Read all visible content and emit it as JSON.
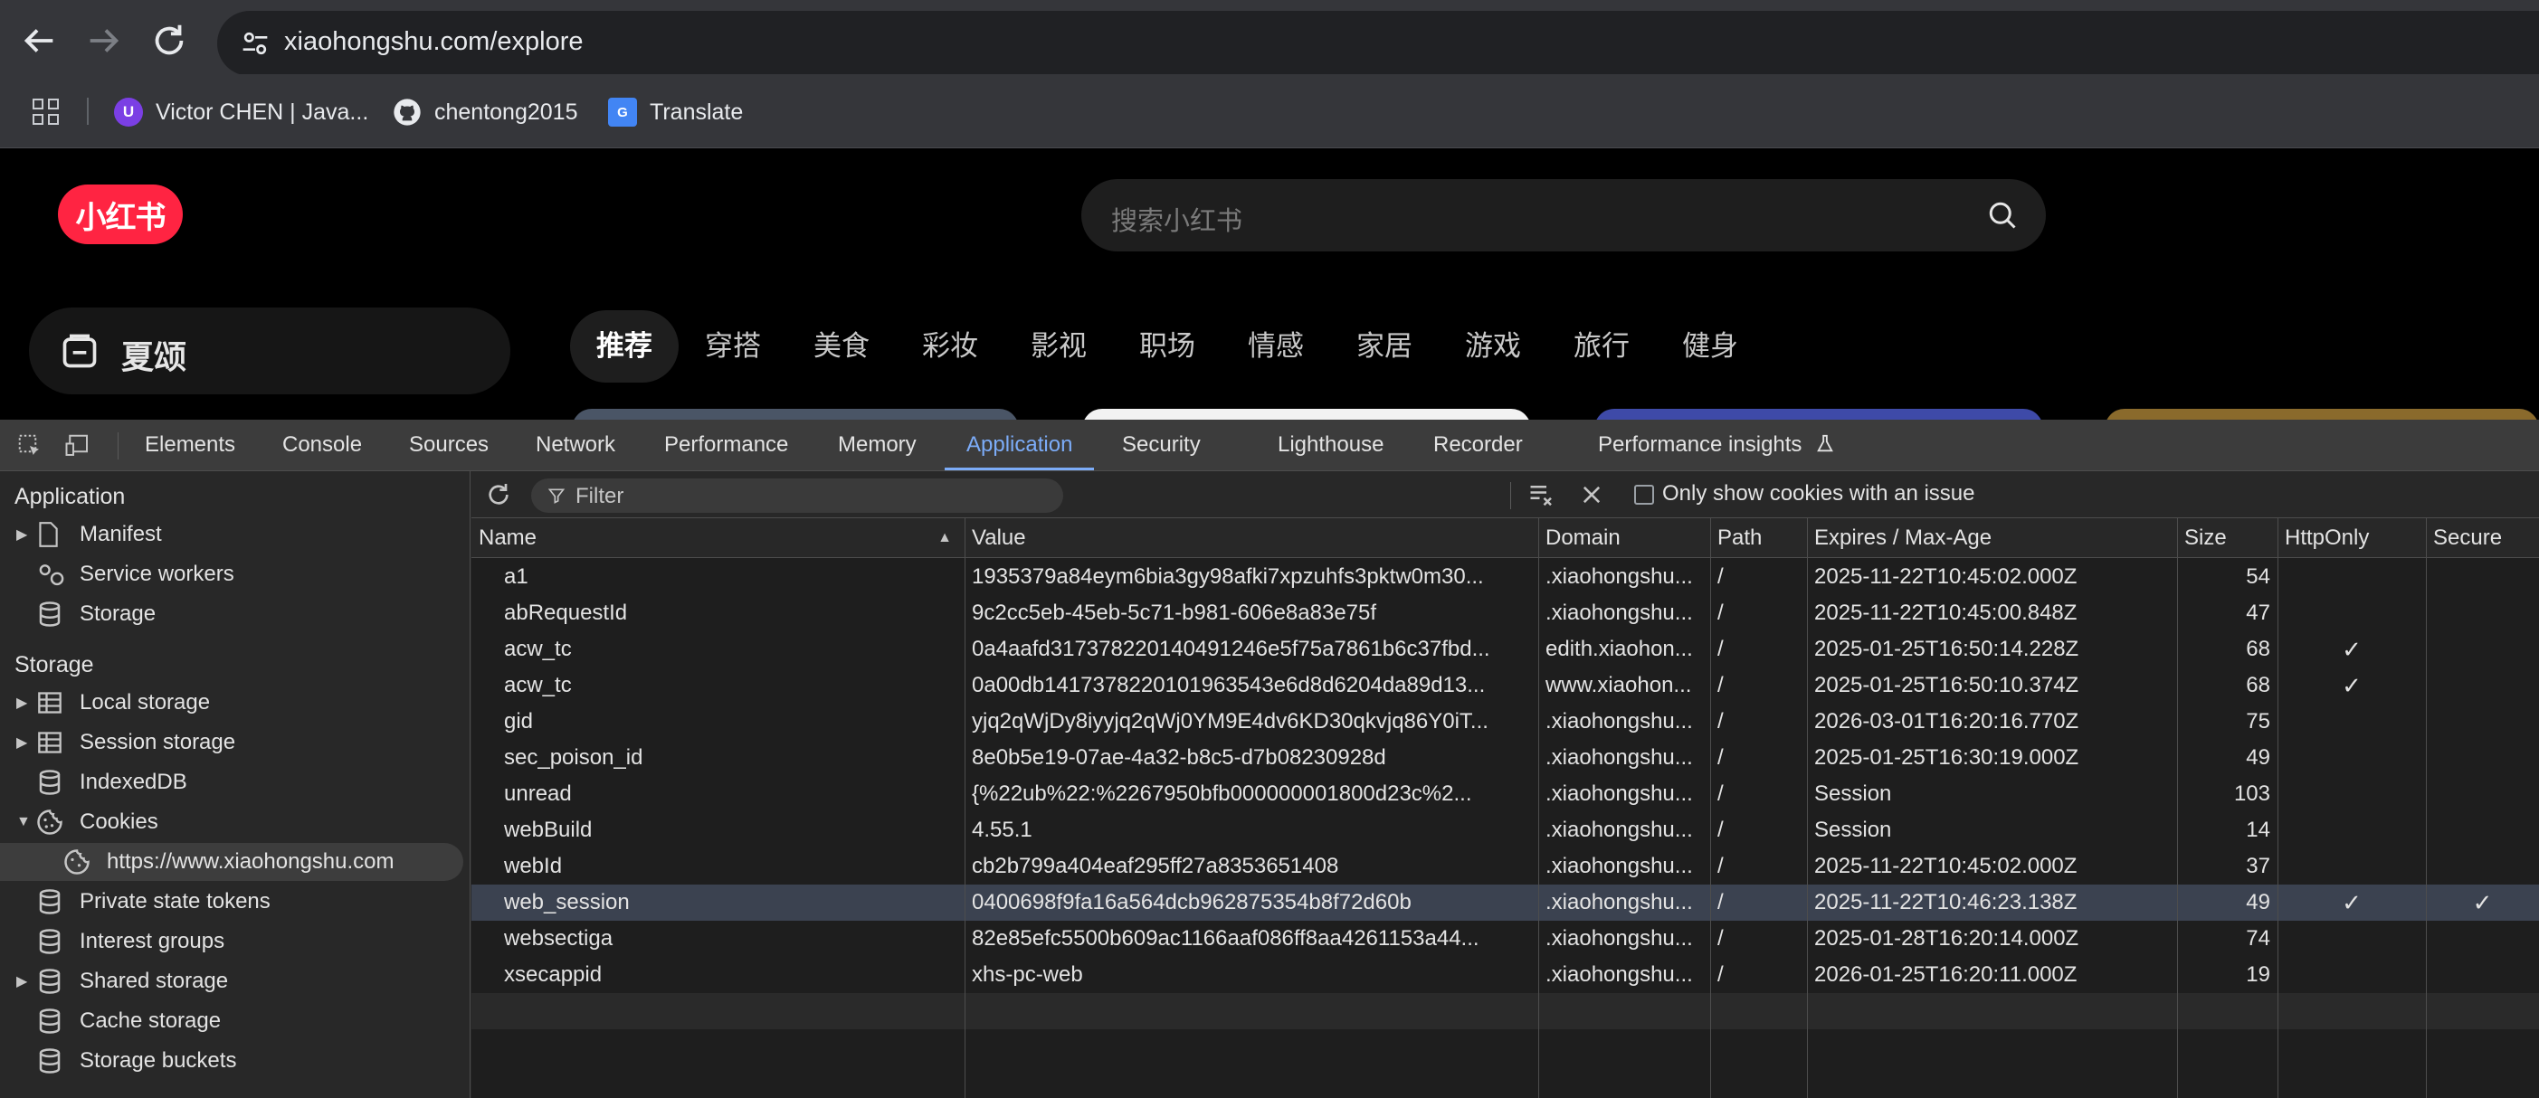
{
  "browser": {
    "url": "xiaohongshu.com/explore",
    "bookmarks": [
      {
        "label": "Victor CHEN | Java...",
        "icon": "avatar-icon"
      },
      {
        "label": "chentong2015",
        "icon": "github-icon"
      },
      {
        "label": "Translate",
        "icon": "translate-icon"
      }
    ]
  },
  "site": {
    "logo_text": "小红书",
    "search_placeholder": "搜索小红书",
    "sidebar_card_label": "夏颂",
    "channels": [
      "推荐",
      "穿搭",
      "美食",
      "彩妆",
      "影视",
      "职场",
      "情感",
      "家居",
      "游戏",
      "旅行",
      "健身"
    ],
    "active_channel": "推荐"
  },
  "devtools": {
    "tabs": [
      "Elements",
      "Console",
      "Sources",
      "Network",
      "Performance",
      "Memory",
      "Application",
      "Security",
      "Lighthouse",
      "Recorder",
      "Performance insights"
    ],
    "active_tab": "Application",
    "sidebar": {
      "application_header": "Application",
      "application_items": [
        "Manifest",
        "Service workers",
        "Storage"
      ],
      "storage_header": "Storage",
      "storage_items": [
        "Local storage",
        "Session storage",
        "IndexedDB",
        "Cookies",
        "https://www.xiaohongshu.com",
        "Private state tokens",
        "Interest groups",
        "Shared storage",
        "Cache storage",
        "Storage buckets"
      ]
    },
    "toolbar": {
      "filter_placeholder": "Filter",
      "only_issue_label": "Only show cookies with an issue"
    },
    "table": {
      "columns": [
        "Name",
        "Value",
        "Domain",
        "Path",
        "Expires / Max-Age",
        "Size",
        "HttpOnly",
        "Secure"
      ],
      "rows": [
        {
          "name": "a1",
          "value": "1935379a84eym6bia3gy98afki7xpzuhfs3pktw0m30...",
          "domain": ".xiaohongshu...",
          "path": "/",
          "expires": "2025-11-22T10:45:02.000Z",
          "size": "54",
          "httponly": "",
          "secure": ""
        },
        {
          "name": "abRequestId",
          "value": "9c2cc5eb-45eb-5c71-b981-606e8a83e75f",
          "domain": ".xiaohongshu...",
          "path": "/",
          "expires": "2025-11-22T10:45:00.848Z",
          "size": "47",
          "httponly": "",
          "secure": ""
        },
        {
          "name": "acw_tc",
          "value": "0a4aafd317378220140491246e5f75a7861b6c37fbd...",
          "domain": "edith.xiaohon...",
          "path": "/",
          "expires": "2025-01-25T16:50:14.228Z",
          "size": "68",
          "httponly": "✓",
          "secure": ""
        },
        {
          "name": "acw_tc",
          "value": "0a00db1417378220101963543e6d8d6204da89d13...",
          "domain": "www.xiaohon...",
          "path": "/",
          "expires": "2025-01-25T16:50:10.374Z",
          "size": "68",
          "httponly": "✓",
          "secure": ""
        },
        {
          "name": "gid",
          "value": "yjq2qWjDy8iyyjq2qWj0YM9E4dv6KD30qkvjq86Y0iT...",
          "domain": ".xiaohongshu...",
          "path": "/",
          "expires": "2026-03-01T16:20:16.770Z",
          "size": "75",
          "httponly": "",
          "secure": ""
        },
        {
          "name": "sec_poison_id",
          "value": "8e0b5e19-07ae-4a32-b8c5-d7b08230928d",
          "domain": ".xiaohongshu...",
          "path": "/",
          "expires": "2025-01-25T16:30:19.000Z",
          "size": "49",
          "httponly": "",
          "secure": ""
        },
        {
          "name": "unread",
          "value": "{%22ub%22:%2267950bfb000000001800d23c%2...",
          "domain": ".xiaohongshu...",
          "path": "/",
          "expires": "Session",
          "size": "103",
          "httponly": "",
          "secure": ""
        },
        {
          "name": "webBuild",
          "value": "4.55.1",
          "domain": ".xiaohongshu...",
          "path": "/",
          "expires": "Session",
          "size": "14",
          "httponly": "",
          "secure": ""
        },
        {
          "name": "webId",
          "value": "cb2b799a404eaf295ff27a8353651408",
          "domain": ".xiaohongshu...",
          "path": "/",
          "expires": "2025-11-22T10:45:02.000Z",
          "size": "37",
          "httponly": "",
          "secure": ""
        },
        {
          "name": "web_session",
          "value": "0400698f9fa16a564dcb962875354b8f72d60b",
          "domain": ".xiaohongshu...",
          "path": "/",
          "expires": "2025-11-22T10:46:23.138Z",
          "size": "49",
          "httponly": "✓",
          "secure": "✓"
        },
        {
          "name": "websectiga",
          "value": "82e85efc5500b609ac1166aaf086ff8aa4261153a44...",
          "domain": ".xiaohongshu...",
          "path": "/",
          "expires": "2025-01-28T16:20:14.000Z",
          "size": "74",
          "httponly": "",
          "secure": ""
        },
        {
          "name": "xsecappid",
          "value": "xhs-pc-web",
          "domain": ".xiaohongshu...",
          "path": "/",
          "expires": "2026-01-25T16:20:11.000Z",
          "size": "19",
          "httponly": "",
          "secure": ""
        }
      ],
      "selected_row": "web_session"
    }
  }
}
